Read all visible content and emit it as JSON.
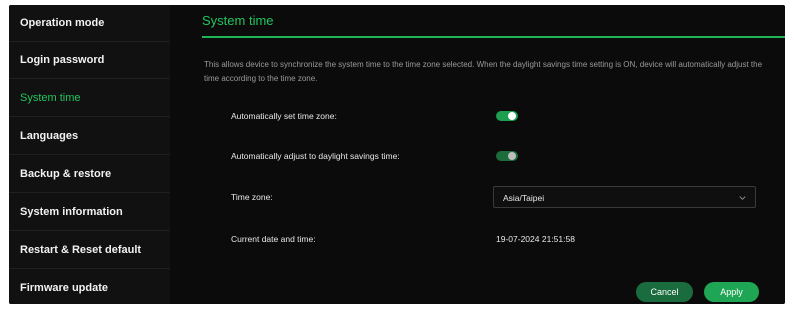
{
  "sidebar": {
    "items": [
      {
        "label": "Operation mode"
      },
      {
        "label": "Login password"
      },
      {
        "label": "System time"
      },
      {
        "label": "Languages"
      },
      {
        "label": "Backup & restore"
      },
      {
        "label": "System information"
      },
      {
        "label": "Restart & Reset default"
      },
      {
        "label": "Firmware update"
      }
    ],
    "active_index": 2
  },
  "page": {
    "title": "System time",
    "description": "This allows device to synchronize the system time to the time zone selected. When the daylight savings time setting is ON, device will automatically adjust the time according to the time zone."
  },
  "settings": {
    "auto_timezone": {
      "label": "Automatically set time zone:",
      "state": "on"
    },
    "auto_dst": {
      "label": "Automatically adjust to daylight savings time:",
      "state": "on"
    },
    "timezone": {
      "label": "Time zone:",
      "value": "Asia/Taipei"
    },
    "current": {
      "label": "Current date and time:",
      "value": "19-07-2024 21:51:58"
    }
  },
  "actions": {
    "cancel_label": "Cancel",
    "apply_label": "Apply"
  },
  "colors": {
    "accent": "#22c55e",
    "background": "#0b0b0b",
    "sidebar": "#111111"
  },
  "icons": {
    "dropdown": "chevron-down-icon"
  }
}
